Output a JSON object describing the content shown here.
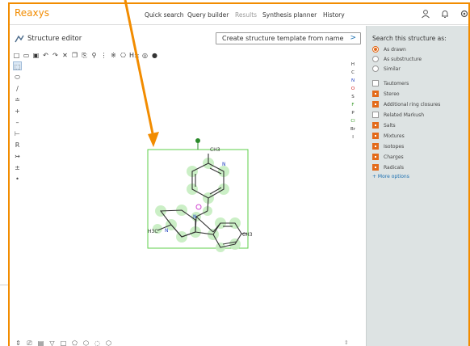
{
  "app": {
    "logo": "Reaxys",
    "nav": [
      "Quick search",
      "Query builder",
      "Results",
      "Synthesis planner",
      "History"
    ]
  },
  "editor": {
    "title": "Structure editor",
    "template_button": "Create structure template from name",
    "template_chevron": ">",
    "elements": [
      "H",
      "C",
      "N",
      "O",
      "S",
      "F",
      "P",
      "Cl",
      "Br",
      "I"
    ],
    "toolbar_icons": [
      "new-icon",
      "open-icon",
      "save-icon",
      "undo-icon",
      "redo-icon",
      "delete-icon",
      "copy-icon",
      "paste-icon",
      "zoom-icon",
      "layout-icon",
      "clean-icon",
      "aromatize-icon",
      "hydrogen-icon",
      "atom-map-icon",
      "info-icon"
    ],
    "hydrogen_toggle": "H±",
    "structure_labels": {
      "methyl_pyridine": "CH3",
      "methyl_n": "H3C",
      "methyl_ring": "CH3",
      "pyridine_n": "N",
      "piperidine_n": "N",
      "indole_n": "N"
    }
  },
  "panel": {
    "title": "Search this structure as:",
    "search_modes": [
      {
        "label": "As drawn",
        "selected": true
      },
      {
        "label": "As substructure",
        "selected": false
      },
      {
        "label": "Similar",
        "selected": false
      }
    ],
    "options": [
      {
        "label": "Tautomers",
        "checked": false
      },
      {
        "label": "Stereo",
        "checked": true
      },
      {
        "label": "Additional ring closures",
        "checked": true
      },
      {
        "label": "Related Markush",
        "checked": false
      },
      {
        "label": "Salts",
        "checked": true
      },
      {
        "label": "Mixtures",
        "checked": true
      },
      {
        "label": "Isotopes",
        "checked": true
      },
      {
        "label": "Charges",
        "checked": true
      },
      {
        "label": "Radicals",
        "checked": true
      }
    ],
    "more_options": "+ More options"
  },
  "colors": {
    "accent_orange": "#f28c00",
    "selection_green": "#5ccf4a",
    "panel_bg": "#dde3e3",
    "link_blue": "#1a6fb0"
  }
}
